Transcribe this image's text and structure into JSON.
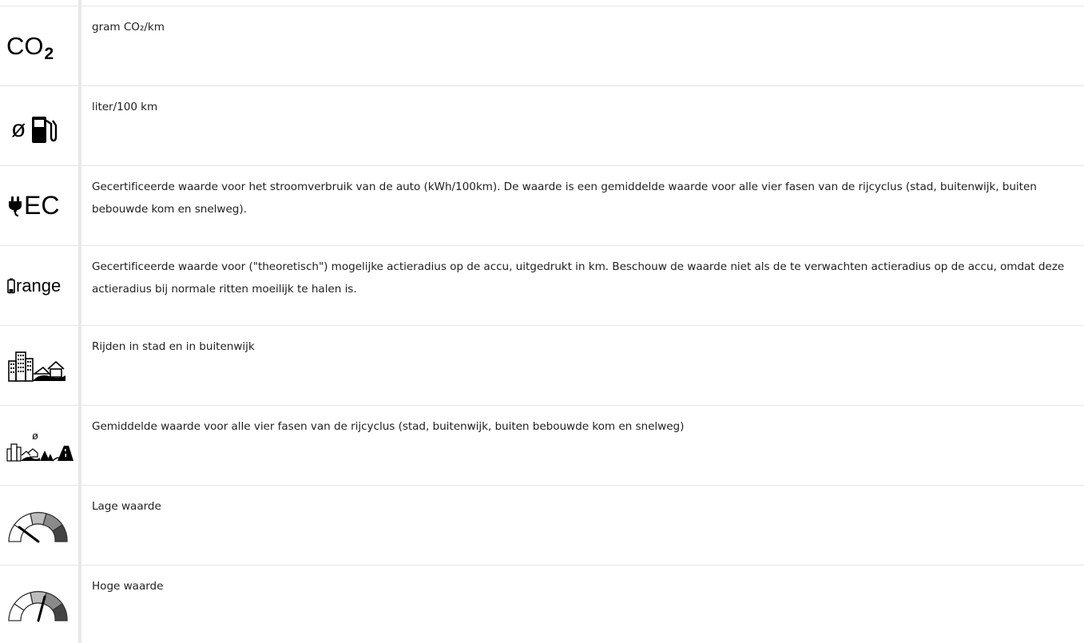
{
  "rows": [
    {
      "icon": "co2-icon",
      "icon_text": "CO",
      "icon_sub": "2",
      "text": "gram CO₂/km"
    },
    {
      "icon": "fuel-consumption-icon",
      "icon_text": "ø",
      "text": "liter/100 km"
    },
    {
      "icon": "energy-consumption-icon",
      "icon_text": "EC",
      "text": "Gecertificeerde waarde voor het stroomverbruik van de auto (kWh/100km). De waarde is een gemiddelde waarde voor alle vier fasen van de rijcyclus (stad, buitenwijk, buiten bebouwde kom en snelweg)."
    },
    {
      "icon": "battery-range-icon",
      "icon_text": "range",
      "text": "Gecertificeerde waarde voor (\"theoretisch\") mogelijke actieradius op de accu, uitgedrukt in km. Beschouw de waarde niet als de te verwachten actieradius op de accu, omdat deze actieradius bij normale ritten moeilijk te halen is."
    },
    {
      "icon": "city-suburb-icon",
      "text": "Rijden in stad en in buitenwijk"
    },
    {
      "icon": "all-phases-average-icon",
      "icon_text": "ø",
      "text": "Gemiddelde waarde voor alle vier fasen van de rijcyclus (stad, buitenwijk, buiten bebouwde kom en snelweg)"
    },
    {
      "icon": "low-value-gauge-icon",
      "text": "Lage waarde"
    },
    {
      "icon": "high-value-gauge-icon",
      "text": "Hoge waarde"
    }
  ],
  "colors": {
    "divider": "#e6e6e6",
    "icon": "#000000",
    "gauge_light": "#bdbdbd",
    "gauge_mid": "#8a8a8a",
    "gauge_dark": "#444444"
  }
}
